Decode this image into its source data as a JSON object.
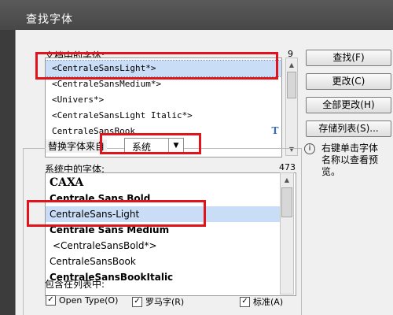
{
  "window": {
    "title": "查找字体"
  },
  "document_fonts": {
    "label": "文档中的字体:",
    "count": "9",
    "items": [
      "<CentraleSansLight*>",
      "<CentraleSansMedium*>",
      "<Univers*>",
      "<CentraleSansLight Italic*>",
      "CentraleSansBook"
    ],
    "selected_index": 0
  },
  "buttons": {
    "find": "查找(F)",
    "change": "更改(C)",
    "change_all": "全部更改(H)",
    "save_list": "存储列表(S)..."
  },
  "replace": {
    "label": "替换字体来自",
    "source": "系统"
  },
  "system_fonts": {
    "label": "系统中的字体:",
    "count": "473",
    "items": [
      {
        "name": "CAXA",
        "icon": "truetype-icon"
      },
      {
        "name": "Centrale Sans Bold",
        "icon": "opentype-icon"
      },
      {
        "name": "CentraleSans-Light",
        "icon": "opentype-icon"
      },
      {
        "name": "Centrale Sans Medium",
        "icon": "opentype-icon"
      },
      {
        "name": "<CentraleSansBold*>",
        "icon": ""
      },
      {
        "name": "CentraleSansBook",
        "icon": "truetype-icon"
      },
      {
        "name": "CentraleSansBookItalic",
        "icon": "truetype-icon"
      }
    ],
    "selected_index": 2
  },
  "info": {
    "icon": "i",
    "text": "右键单击字体名称以查看预览。"
  },
  "include_in_list": {
    "label": "包含在列表中:",
    "options": [
      {
        "label": "Open Type(O)",
        "checked": true
      },
      {
        "label": "罗马字(R)",
        "checked": true
      },
      {
        "label": "标准(A)",
        "checked": true
      }
    ]
  },
  "annotation_color": "#e1141c"
}
